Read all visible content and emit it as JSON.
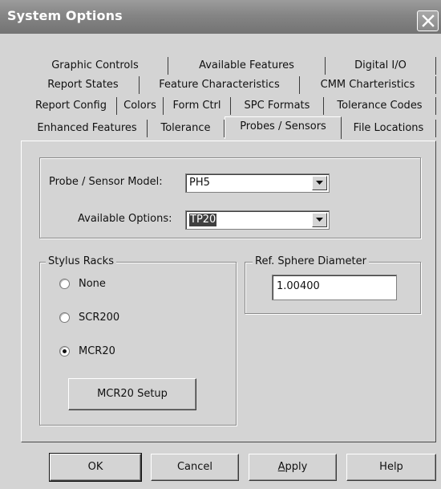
{
  "window": {
    "title": "System Options"
  },
  "tabs": {
    "row1": [
      "Graphic Controls",
      "Available Features",
      "Digital I/O"
    ],
    "row2": [
      "Report States",
      "Feature Characteristics",
      "CMM Charteristics"
    ],
    "row3": [
      "Report Config",
      "Colors",
      "Form Ctrl",
      "SPC Formats",
      "Tolerance Codes"
    ],
    "row4": [
      "Enhanced Features",
      "Tolerance",
      "Probes / Sensors",
      "File Locations"
    ],
    "selected": "Probes / Sensors"
  },
  "probe": {
    "model_label": "Probe / Sensor Model:",
    "model_value": "PH5",
    "options_label": "Available Options:",
    "options_value": "TP20"
  },
  "stylus_racks": {
    "title": "Stylus Racks",
    "options": [
      "None",
      "SCR200",
      "MCR20"
    ],
    "selected": "MCR20",
    "setup_button": "MCR20 Setup"
  },
  "ref_sphere": {
    "title": "Ref. Sphere Diameter",
    "value": "1.00400"
  },
  "buttons": {
    "ok": "OK",
    "cancel": "Cancel",
    "apply_prefix": "A",
    "apply_rest": "pply",
    "help": "Help"
  }
}
